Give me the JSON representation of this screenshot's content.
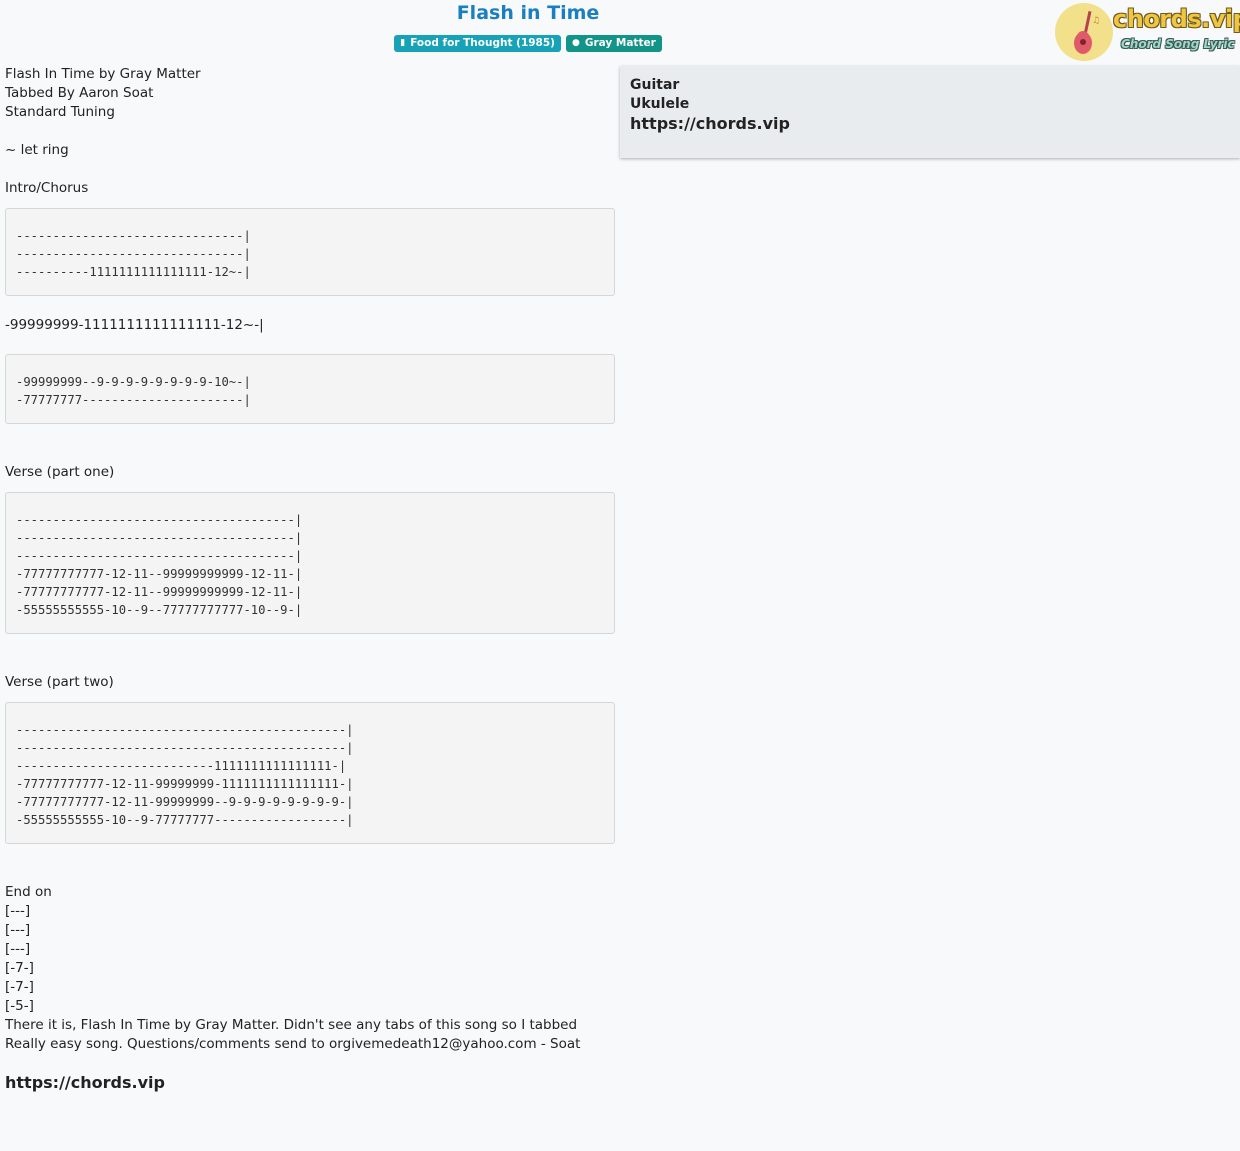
{
  "header": {
    "title": "Flash in Time",
    "badges": [
      {
        "icon": "book-icon",
        "label": "Food for Thought (1985)"
      },
      {
        "icon": "user-icon",
        "label": "Gray Matter"
      }
    ],
    "logo": {
      "text": "chords.vip",
      "subtitle": "Chord Song Lyric",
      "colors": {
        "circle": "#f3e08a",
        "guitar": "#e05a6a"
      }
    }
  },
  "sidebar": {
    "items": [
      "Guitar",
      "Ukulele"
    ],
    "url": "https://chords.vip"
  },
  "content": {
    "intro_lines": [
      "Flash In Time by Gray Matter",
      "Tabbed By Aaron Soat",
      "Standard Tuning",
      "",
      "~ let ring",
      "",
      "Intro/Chorus"
    ],
    "tab1": "-------------------------------|\n-------------------------------|\n----------1111111111111111-12~-|",
    "mid_line": "-99999999-1111111111111111-12~-|",
    "tab2": "-99999999--9-9-9-9-9-9-9-9-10~-|\n-77777777----------------------|",
    "verse1_label": "Verse (part one)",
    "tab3": "--------------------------------------|\n--------------------------------------|\n--------------------------------------|\n-77777777777-12-11--99999999999-12-11-|\n-77777777777-12-11--99999999999-12-11-|\n-55555555555-10--9--77777777777-10--9-|",
    "verse2_label": "Verse (part two)",
    "tab4": "---------------------------------------------|\n---------------------------------------------|\n---------------------------1111111111111111-|\n-77777777777-12-11-99999999-1111111111111111-|\n-77777777777-12-11-99999999--9-9-9-9-9-9-9-9-|\n-55555555555-10--9-77777777------------------|",
    "end_lines": [
      "End on",
      "[---]",
      "[---]",
      "[---]",
      "[-7-]",
      "[-7-]",
      "[-5-]",
      "There it is, Flash In Time by Gray Matter. Didn't see any tabs of this song so I tabbed",
      "Really easy song. Questions/comments send to orgivemedeath12@yahoo.com - Soat"
    ],
    "footer_url": "https://chords.vip"
  }
}
